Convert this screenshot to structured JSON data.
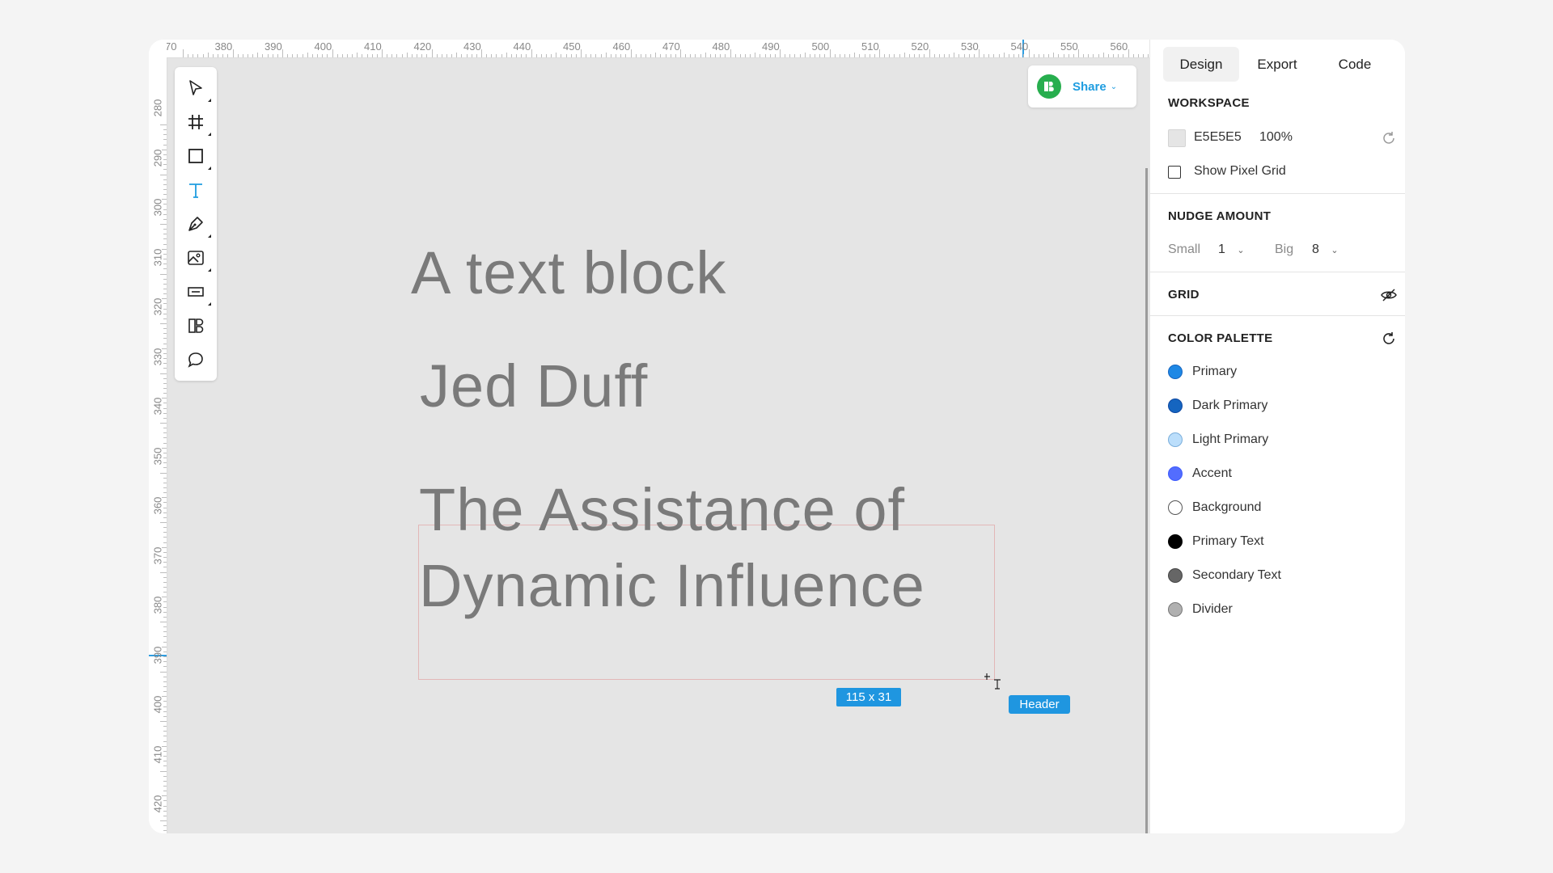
{
  "ruler": {
    "top": [
      "70",
      "380",
      "390",
      "400",
      "410",
      "420",
      "430",
      "440",
      "450",
      "460",
      "470",
      "480",
      "490",
      "500",
      "510",
      "520",
      "530",
      "540",
      "550",
      "560"
    ],
    "left": [
      "280",
      "290",
      "300",
      "310",
      "320",
      "330",
      "340",
      "350",
      "360",
      "370",
      "380",
      "390",
      "400",
      "410",
      "420"
    ]
  },
  "toolbar": {
    "tools": [
      {
        "name": "select-tool",
        "icon": "arrow-cursor-icon"
      },
      {
        "name": "frame-tool",
        "icon": "frame-hash-icon"
      },
      {
        "name": "rectangle-tool",
        "icon": "square-icon"
      },
      {
        "name": "text-tool",
        "icon": "text-T-icon",
        "active": true
      },
      {
        "name": "pen-tool",
        "icon": "pen-nib-icon"
      },
      {
        "name": "image-tool",
        "icon": "image-icon"
      },
      {
        "name": "input-tool",
        "icon": "input-field-icon"
      },
      {
        "name": "components-tool",
        "icon": "components-icon"
      },
      {
        "name": "comment-tool",
        "icon": "speech-bubble-icon"
      }
    ]
  },
  "share": {
    "label": "Share"
  },
  "canvas": {
    "text1": "A text block",
    "text2": "Jed Duff",
    "text3_line1": "The Assistance of",
    "text3_line2": "Dynamic Influence",
    "size_badge": "115 x 31",
    "layer_badge": "Header"
  },
  "panel": {
    "tabs": [
      "Design",
      "Export",
      "Code"
    ],
    "workspace": {
      "title": "WORKSPACE",
      "color_hex": "E5E5E5",
      "opacity": "100%",
      "pixel_grid_label": "Show Pixel Grid"
    },
    "nudge": {
      "title": "NUDGE AMOUNT",
      "small_label": "Small",
      "small_value": "1",
      "big_label": "Big",
      "big_value": "8"
    },
    "grid": {
      "title": "GRID"
    },
    "palette": {
      "title": "COLOR PALETTE",
      "colors": [
        {
          "label": "Primary",
          "color": "#1e88e5",
          "outline": "#1565c0"
        },
        {
          "label": "Dark Primary",
          "color": "#1565c0",
          "outline": "#0d47a1"
        },
        {
          "label": "Light Primary",
          "color": "#bbdefb",
          "outline": "#7aaedb"
        },
        {
          "label": "Accent",
          "color": "#536dfe",
          "outline": "#3d5afe"
        },
        {
          "label": "Background",
          "color": "#ffffff",
          "outline": "#555555"
        },
        {
          "label": "Primary Text",
          "color": "#000000",
          "outline": "#000000"
        },
        {
          "label": "Secondary Text",
          "color": "#666666",
          "outline": "#444444"
        },
        {
          "label": "Divider",
          "color": "#b0b0b0",
          "outline": "#777777"
        }
      ]
    }
  }
}
